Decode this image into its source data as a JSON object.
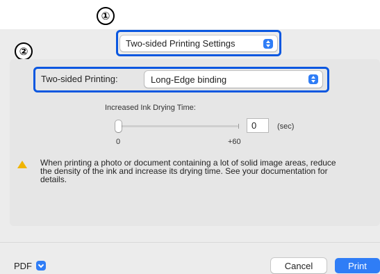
{
  "callouts": {
    "one": "①",
    "two": "②"
  },
  "top_menu": {
    "value": "Two-sided Printing Settings",
    "icon": "stepper-icon"
  },
  "two_sided": {
    "label": "Two-sided Printing:",
    "value": "Long-Edge binding",
    "icon": "stepper-icon"
  },
  "drying": {
    "title": "Increased Ink Drying Time:",
    "value": "0",
    "unit": "(sec)",
    "min_label": "0",
    "max_label": "+60",
    "slider_fraction": 0.0
  },
  "note": {
    "icon": "warning-icon",
    "text": "When printing a photo or document containing a lot of solid image areas, reduce the density of the ink and increase its drying time. See your documentation for details."
  },
  "footer": {
    "pdf_label": "PDF",
    "pdf_icon": "chevron-down-icon",
    "cancel_label": "Cancel",
    "print_label": "Print"
  },
  "colors": {
    "highlight": "#0a57e0",
    "accent": "#2f7df6",
    "warning": "#f0b400"
  }
}
